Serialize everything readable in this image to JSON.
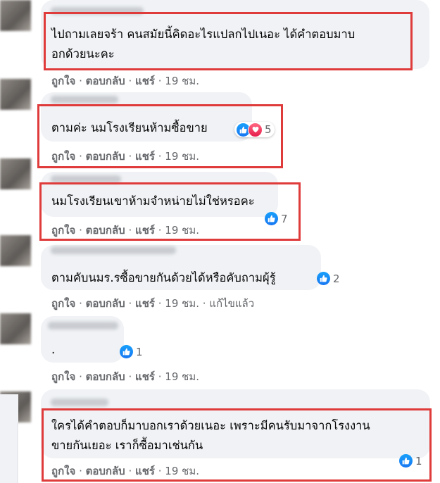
{
  "actions": {
    "like": "ถูกใจ",
    "reply": "ตอบกลับ",
    "share": "แชร์",
    "sep": "·"
  },
  "comments": [
    {
      "lines": [
        "ไปถามเลยจร้า คนสมัยนี้คิดอะไรแปลกไปเนอะ ได้คำตอบมาบ",
        "อกด้วยนะคะ"
      ],
      "time": "19 ชม.",
      "reaction_count": null,
      "highlighted": true
    },
    {
      "lines": [
        "ตามค่ะ นมโรงเรียนห้ามซื้อขาย"
      ],
      "time": "19 ชม.",
      "reactions": [
        "like",
        "love"
      ],
      "reaction_count": "5",
      "highlighted": true
    },
    {
      "lines": [
        "นมโรงเรียนเขาห้ามจำหน่ายไม่ใช่หรอคะ"
      ],
      "time": "19 ชม.",
      "reactions": [
        "like"
      ],
      "reaction_count": "7",
      "highlighted": true
    },
    {
      "lines": [
        "ตามคับนมร.รซื้อขายกันด้วยได้หรือคับถามผุ้รู้"
      ],
      "time": "19 ชม.",
      "edited": "แก้ไขแล้ว",
      "reactions": [
        "like"
      ],
      "reaction_count": "2",
      "highlighted": false
    },
    {
      "lines": [
        "."
      ],
      "time": "19 ชม.",
      "reactions": [
        "like"
      ],
      "reaction_count": "1",
      "highlighted": false
    },
    {
      "lines": [
        "ใครได้คำตอบก็มาบอกเราด้วยเนอะ เพราะมีคนรับมาจากโรงงาน",
        "ขายกันเยอะ เราก็ซื้อมาเช่นกัน"
      ],
      "time": "19 ชม.",
      "reactions": [
        "like"
      ],
      "reaction_count": "1",
      "highlighted": true
    }
  ],
  "colors": {
    "highlight": "#e03b3b",
    "like_blue": "#1877f2",
    "love_red": "#e61e4d",
    "bubble": "#f0f2f5",
    "meta_text": "#65676b"
  }
}
